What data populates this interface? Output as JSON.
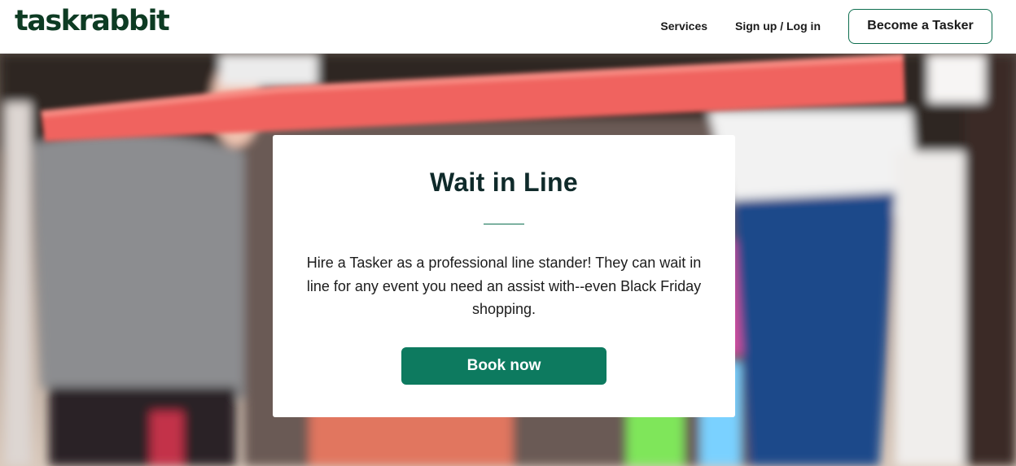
{
  "header": {
    "logo_text": "taskrabbit",
    "nav": {
      "services_label": "Services",
      "signup_label": "Sign up / Log in",
      "become_tasker_label": "Become a Tasker"
    }
  },
  "hero": {
    "image_subject": "people waiting in line behind a red rope barrier"
  },
  "card": {
    "title": "Wait in Line",
    "description": "Hire a Tasker as a professional line stander! They can wait in line for any event you need an assist with--even Black Friday shopping.",
    "cta_label": "Book now"
  },
  "colors": {
    "brand_green": "#0d7a5f",
    "logo_green": "#0d3b23",
    "rope_red": "#f0645f"
  }
}
